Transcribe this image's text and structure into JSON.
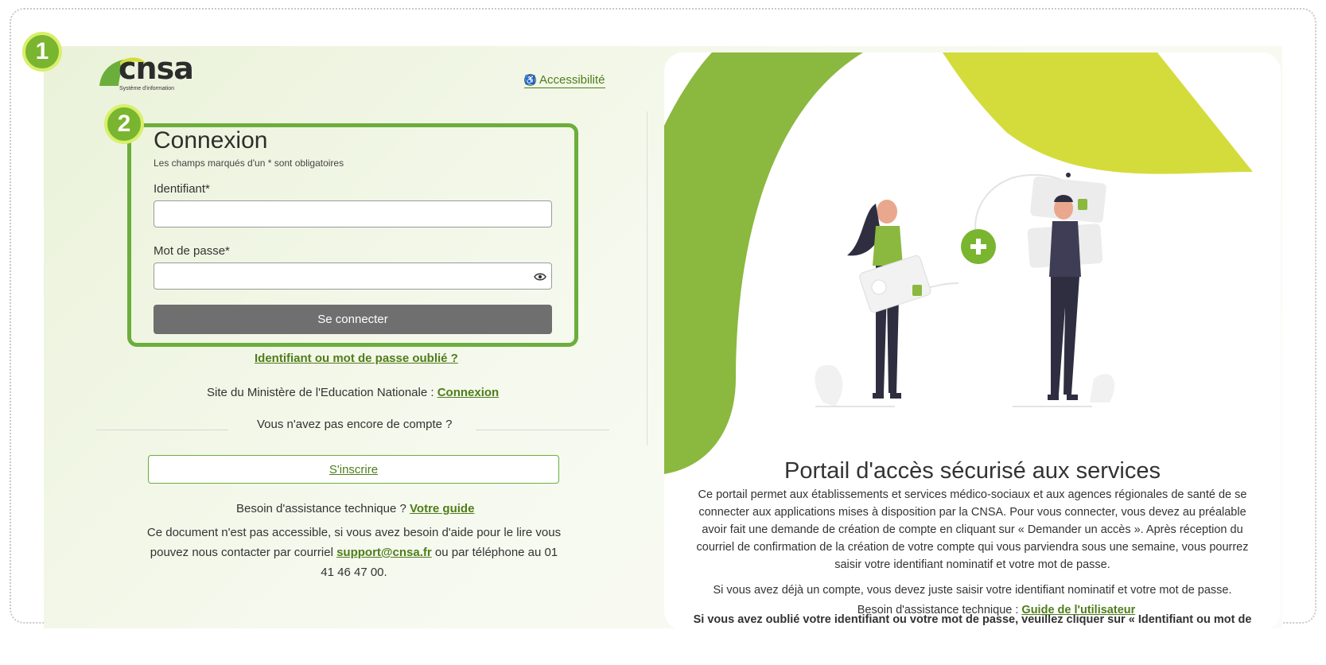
{
  "badges": [
    "1",
    "2"
  ],
  "logo": {
    "text": "cnsa",
    "subtitle": "Système d'information"
  },
  "header": {
    "accessibility_icon": "accessibility-icon",
    "accessibility_label": "Accessibilité"
  },
  "login": {
    "title": "Connexion",
    "required_note": "Les champs marqués d'un * sont obligatoires",
    "identifier_label": "Identifiant*",
    "identifier_value": "",
    "password_label": "Mot de passe*",
    "password_value": "",
    "show_password_icon": "eye-icon",
    "submit_label": "Se connecter",
    "forgot_link": "Identifiant ou mot de passe oublié ?"
  },
  "ministere": {
    "text": "Site du Ministère de l'Education Nationale : ",
    "link": "Connexion"
  },
  "signup": {
    "prompt": "Vous n'avez pas encore de compte ?",
    "button": "S'inscrire"
  },
  "assistance": {
    "text": "Besoin d'assistance technique ? ",
    "link": "Votre guide",
    "doc_text_1": "Ce document n'est pas accessible, si vous avez besoin d'aide pour le lire vous pouvez nous contacter par courriel ",
    "email": "support@cnsa.fr",
    "doc_text_2": " ou par téléphone au 01 41 46 47 00."
  },
  "portal": {
    "title": "Portail d'accès sécurisé aux services",
    "p1": "Ce portail permet aux établissements et services médico-sociaux et aux agences régionales de santé de se connecter aux applications mises à disposition par la CNSA. Pour vous connecter, vous devez au préalable avoir fait une demande de création de compte en cliquant sur « Demander un accès ». Après réception du courriel de confirmation de la création de votre compte qui vous parviendra sous une semaine, vous pourrez saisir votre identifiant nominatif et votre mot de passe.",
    "p2": "Si vous avez déjà un compte, vous devez juste saisir votre identifiant nominatif et votre mot de passe.",
    "p3": "Si vous avez oublié votre identifiant ou votre mot de passe, veuillez cliquer sur « Identifiant ou mot de passe oublié ».",
    "assist_text": "Besoin d'assistance technique : ",
    "assist_link": "Guide de l'utilisateur"
  },
  "colors": {
    "brand_green": "#6cae3c",
    "link_green": "#4f7d1a",
    "lime": "#d4dc3c",
    "button_gray": "#6f6f6f"
  }
}
